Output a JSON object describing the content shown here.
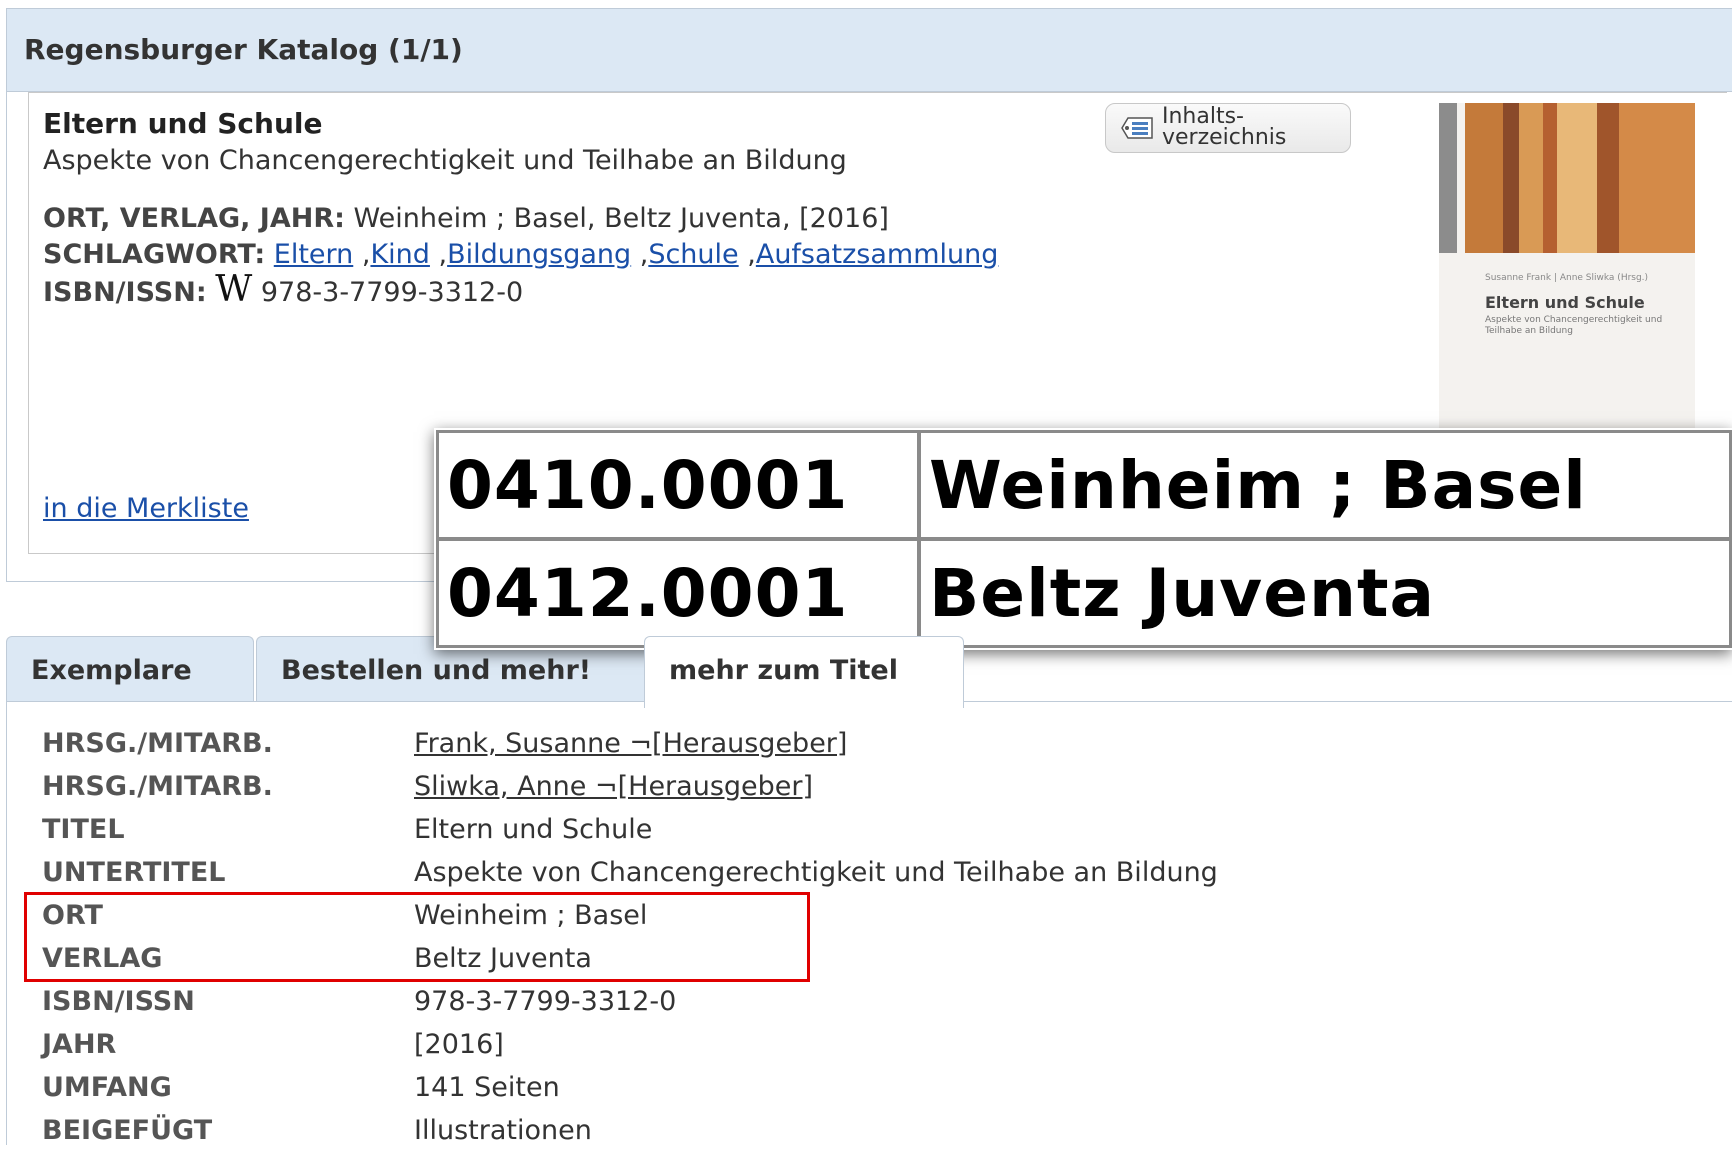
{
  "panel": {
    "title": "Regensburger Katalog (1/1)"
  },
  "record": {
    "title": "Eltern und Schule",
    "subtitle": "Aspekte von Chancengerechtigkeit und Teilhabe an Bildung",
    "ort_label": "ORT, VERLAG, JAHR:",
    "ort_value": "Weinheim ; Basel, Beltz Juventa, [2016]",
    "schlagwort_label": "SCHLAGWORT:",
    "schlagworte": [
      "Eltern",
      "Kind",
      "Bildungsgang",
      "Schule",
      "Aufsatzsammlung"
    ],
    "isbn_label": "ISBN/ISSN:",
    "isbn_icon_glyph": "W",
    "isbn_value": "978-3-7799-3312-0",
    "merkliste_link": "in die Merkliste",
    "toc_button": "Inhalts-verzeichnis",
    "toc_button_line1": "Inhalts-",
    "toc_button_line2": "verzeichnis"
  },
  "cover": {
    "authors": "Susanne Frank | Anne Sliwka (Hrsg.)",
    "title": "Eltern und Schule",
    "subtitle": "Aspekte von Chancengerechtigkeit und Teilhabe an Bildung"
  },
  "tabs": [
    {
      "label": "Exemplare"
    },
    {
      "label": "Bestellen und mehr!"
    },
    {
      "label": "mehr zum Titel"
    }
  ],
  "fields": [
    {
      "label": "HRSG./MITARB.",
      "value": "Frank, Susanne ¬[Herausgeber]",
      "link": true
    },
    {
      "label": "HRSG./MITARB.",
      "value": "Sliwka, Anne ¬[Herausgeber]",
      "link": true
    },
    {
      "label": "TITEL",
      "value": "Eltern und Schule",
      "link": false
    },
    {
      "label": "UNTERTITEL",
      "value": "Aspekte von Chancengerechtigkeit und Teilhabe an Bildung",
      "link": false
    },
    {
      "label": "ORT",
      "value": "Weinheim ; Basel",
      "link": false
    },
    {
      "label": "VERLAG",
      "value": "Beltz Juventa",
      "link": false
    },
    {
      "label": "ISBN/ISSN",
      "value": "978-3-7799-3312-0",
      "link": false
    },
    {
      "label": "JAHR",
      "value": "[2016]",
      "link": false
    },
    {
      "label": "UMFANG",
      "value": "141 Seiten",
      "link": false
    },
    {
      "label": "BEIGEFÜGT",
      "value": "Illustrationen",
      "link": false
    }
  ],
  "zoom": {
    "rows": [
      {
        "code": "0410.0001",
        "value": "Weinheim ; Basel"
      },
      {
        "code": "0412.0001",
        "value": "Beltz Juventa"
      }
    ]
  },
  "colors": {
    "header_bg": "#dce8f4",
    "link": "#1a4fa8",
    "highlight": "#e00000",
    "cover_stripes": [
      "#c47a3a",
      "#8a4a2a",
      "#d99a55",
      "#b56030",
      "#e8b878"
    ]
  }
}
